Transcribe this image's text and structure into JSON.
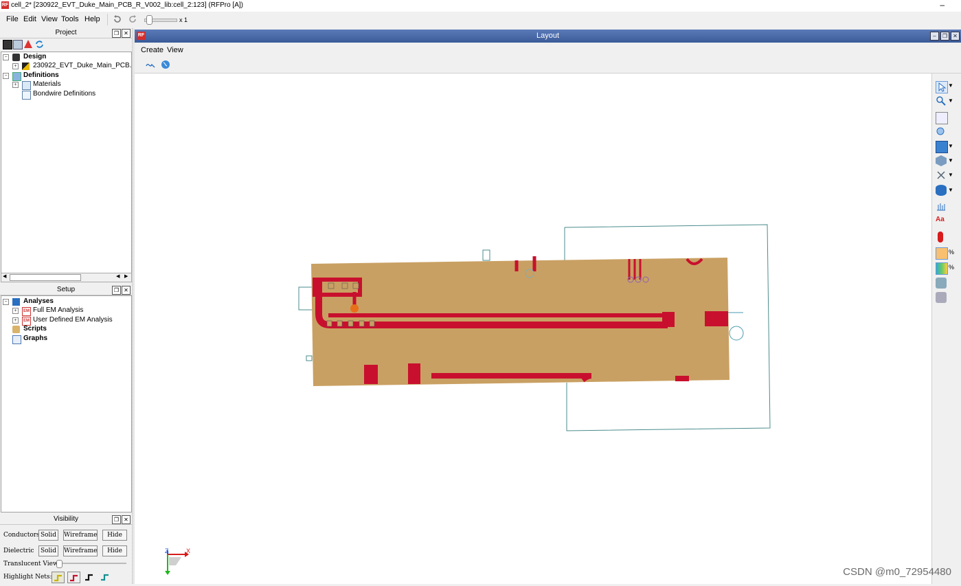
{
  "window": {
    "title": "cell_2* [230922_EVT_Duke_Main_PCB_R_V002_lib:cell_2:123] (RFPro [A])",
    "logo": "RF",
    "minimize_glyph": "–"
  },
  "menubar": {
    "items": [
      "File",
      "Edit",
      "View",
      "Tools",
      "Help"
    ],
    "zoom_label": "x 1"
  },
  "project_panel": {
    "title": "Project",
    "tree": {
      "design": "Design",
      "design_child": "230922_EVT_Duke_Main_PCB...",
      "definitions": "Definitions",
      "materials": "Materials",
      "bondwire": "Bondwire Definitions"
    }
  },
  "setup_panel": {
    "title": "Setup",
    "tree": {
      "analyses": "Analyses",
      "full_em": "Full EM Analysis",
      "user_em": "User Defined EM Analysis",
      "scripts": "Scripts",
      "graphs": "Graphs",
      "em_badge": "EM"
    }
  },
  "visibility_panel": {
    "title": "Visibility",
    "conductors_label": "Conductors",
    "dielectric_label": "Dielectric",
    "solid": "Solid",
    "wireframe": "Wireframe",
    "hide": "Hide",
    "translucent_label": "Translucent View:",
    "highlight_label": "Highlight Nets:"
  },
  "layout_window": {
    "title": "Layout",
    "logo": "RF",
    "menu": [
      "Create",
      "View"
    ],
    "axis_x": "X",
    "axis_z": "Z"
  },
  "watermark": "CSDN @m0_72954480",
  "colors": {
    "board": "#c9a063",
    "copper": "#c8102e",
    "outline": "#4a8b8b",
    "titlebar_blue": "#3a5a98"
  }
}
